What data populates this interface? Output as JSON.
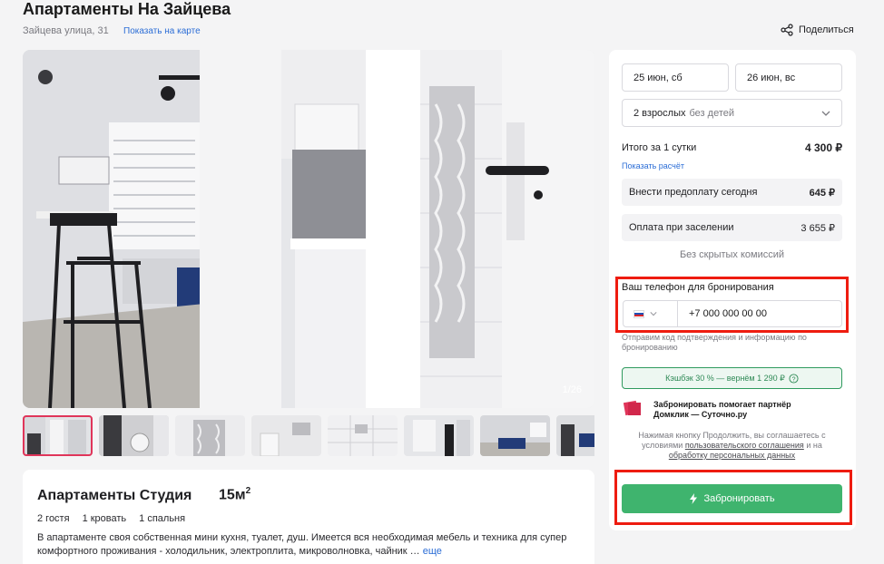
{
  "listing": {
    "title": "Апартаменты На Зайцева",
    "address": "Зайцева улица, 31",
    "map_link": "Показать на карте",
    "share_label": "Поделиться"
  },
  "gallery": {
    "counter": "1/26",
    "thumb_count": 8
  },
  "room": {
    "title": "Апартаменты Студия",
    "area": "15м",
    "area_sup": "2",
    "guests": "2 гостя",
    "beds": "1 кровать",
    "bedrooms": "1 спальня",
    "description": "В апартаменте своя собственная мини кухня, туалет, душ. Имеется вся необходимая мебель и техника для супер комфортного проживания - холодильник, электроплита, микроволновка, чайник …",
    "more_link": "еще"
  },
  "booking": {
    "checkin": "25 июн, сб",
    "checkout": "26 июн, вс",
    "guests_main": "2 взрослых",
    "guests_sub": "без детей",
    "total_label": "Итого за 1 сутки",
    "total_value": "4 300 ₽",
    "calc_link": "Показать расчёт",
    "prepay_label": "Внести предоплату сегодня",
    "prepay_value": "645 ₽",
    "checkin_pay_label": "Оплата при заселении",
    "checkin_pay_value": "3 655 ₽",
    "no_fees": "Без скрытых комиссий",
    "phone_label": "Ваш телефон для бронирования",
    "phone_value": "+7 000 000 00 00",
    "phone_hint": "Отправим код подтверждения и информацию по бронированию",
    "cashback": "Кэшбэк 30 % — вернём 1 290 ₽",
    "partner": "Забронировать помогает партнёр Домклик — Суточно.ру",
    "terms_prefix": "Нажимая кнопку Продолжить, вы соглашаетесь с условиями",
    "terms_link1": "пользовательского соглашения",
    "terms_mid": "и на",
    "terms_link2": "обработку персональных данных",
    "book_button": "Забронировать"
  },
  "colors": {
    "accent_green": "#3fb46e",
    "link_blue": "#2b6dd6",
    "highlight_red": "#ee1c10"
  }
}
